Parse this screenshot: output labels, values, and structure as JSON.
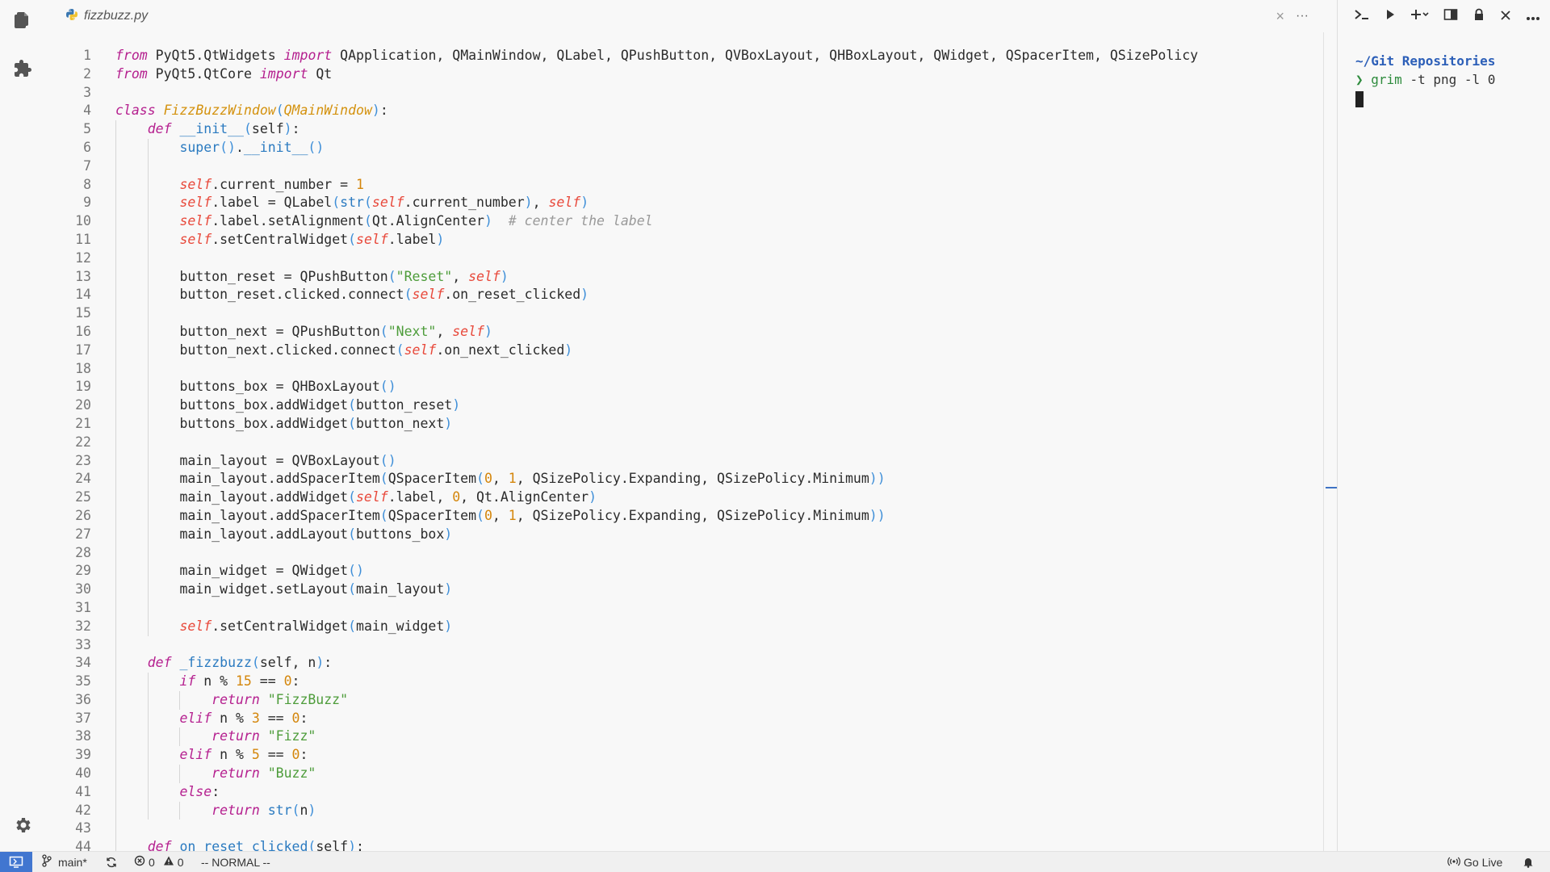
{
  "editor": {
    "tab": {
      "filename": "fizzbuzz.py",
      "icon": "python-icon",
      "close": "×",
      "more": "···"
    },
    "code_lines": [
      {
        "n": "1",
        "indent": 0,
        "t": [
          [
            "kw",
            "from"
          ],
          [
            "p",
            " PyQt5.QtWidgets "
          ],
          [
            "kw",
            "import"
          ],
          [
            "p",
            " QApplication, QMainWindow, QLabel, QPushButton, QVBoxLayout, QHBoxLayout, QWidget, QSpacerItem, QSizePolicy"
          ]
        ]
      },
      {
        "n": "2",
        "indent": 0,
        "t": [
          [
            "kw",
            "from"
          ],
          [
            "p",
            " PyQt5.QtCore "
          ],
          [
            "kw",
            "import"
          ],
          [
            "p",
            " Qt"
          ]
        ]
      },
      {
        "n": "3",
        "indent": 0,
        "t": []
      },
      {
        "n": "4",
        "indent": 0,
        "t": [
          [
            "kw",
            "class"
          ],
          [
            "p",
            " "
          ],
          [
            "cls",
            "FizzBuzzWindow"
          ],
          [
            "br",
            "("
          ],
          [
            "cls",
            "QMainWindow"
          ],
          [
            "br",
            ")"
          ],
          [
            "p",
            ":"
          ]
        ]
      },
      {
        "n": "5",
        "indent": 1,
        "t": [
          [
            "kw",
            "def"
          ],
          [
            "p",
            " "
          ],
          [
            "fn",
            "__init__"
          ],
          [
            "br",
            "("
          ],
          [
            "p",
            "self"
          ],
          [
            "br",
            ")"
          ],
          [
            "p",
            ":"
          ]
        ]
      },
      {
        "n": "6",
        "indent": 2,
        "t": [
          [
            "fn",
            "super"
          ],
          [
            "br",
            "()"
          ],
          [
            "p",
            "."
          ],
          [
            "fn",
            "__init__"
          ],
          [
            "br",
            "()"
          ]
        ]
      },
      {
        "n": "7",
        "indent": 2,
        "t": []
      },
      {
        "n": "8",
        "indent": 2,
        "t": [
          [
            "self",
            "self"
          ],
          [
            "p",
            ".current_number = "
          ],
          [
            "num",
            "1"
          ]
        ]
      },
      {
        "n": "9",
        "indent": 2,
        "t": [
          [
            "self",
            "self"
          ],
          [
            "p",
            ".label = QLabel"
          ],
          [
            "br",
            "("
          ],
          [
            "fn",
            "str"
          ],
          [
            "br",
            "("
          ],
          [
            "self",
            "self"
          ],
          [
            "p",
            ".current_number"
          ],
          [
            "br",
            ")"
          ],
          [
            "p",
            ", "
          ],
          [
            "self",
            "self"
          ],
          [
            "br",
            ")"
          ]
        ]
      },
      {
        "n": "10",
        "indent": 2,
        "t": [
          [
            "self",
            "self"
          ],
          [
            "p",
            ".label.setAlignment"
          ],
          [
            "br",
            "("
          ],
          [
            "p",
            "Qt.AlignCenter"
          ],
          [
            "br",
            ")"
          ],
          [
            "p",
            "  "
          ],
          [
            "cm",
            "# center the label"
          ]
        ]
      },
      {
        "n": "11",
        "indent": 2,
        "t": [
          [
            "self",
            "self"
          ],
          [
            "p",
            ".setCentralWidget"
          ],
          [
            "br",
            "("
          ],
          [
            "self",
            "self"
          ],
          [
            "p",
            ".label"
          ],
          [
            "br",
            ")"
          ]
        ]
      },
      {
        "n": "12",
        "indent": 2,
        "t": []
      },
      {
        "n": "13",
        "indent": 2,
        "t": [
          [
            "p",
            "button_reset = QPushButton"
          ],
          [
            "br",
            "("
          ],
          [
            "str",
            "\"Reset\""
          ],
          [
            "p",
            ", "
          ],
          [
            "self",
            "self"
          ],
          [
            "br",
            ")"
          ]
        ]
      },
      {
        "n": "14",
        "indent": 2,
        "t": [
          [
            "p",
            "button_reset.clicked.connect"
          ],
          [
            "br",
            "("
          ],
          [
            "self",
            "self"
          ],
          [
            "p",
            ".on_reset_clicked"
          ],
          [
            "br",
            ")"
          ]
        ]
      },
      {
        "n": "15",
        "indent": 2,
        "t": []
      },
      {
        "n": "16",
        "indent": 2,
        "t": [
          [
            "p",
            "button_next = QPushButton"
          ],
          [
            "br",
            "("
          ],
          [
            "str",
            "\"Next\""
          ],
          [
            "p",
            ", "
          ],
          [
            "self",
            "self"
          ],
          [
            "br",
            ")"
          ]
        ]
      },
      {
        "n": "17",
        "indent": 2,
        "t": [
          [
            "p",
            "button_next.clicked.connect"
          ],
          [
            "br",
            "("
          ],
          [
            "self",
            "self"
          ],
          [
            "p",
            ".on_next_clicked"
          ],
          [
            "br",
            ")"
          ]
        ]
      },
      {
        "n": "18",
        "indent": 2,
        "t": []
      },
      {
        "n": "19",
        "indent": 2,
        "t": [
          [
            "p",
            "buttons_box = QHBoxLayout"
          ],
          [
            "br",
            "()"
          ]
        ]
      },
      {
        "n": "20",
        "indent": 2,
        "t": [
          [
            "p",
            "buttons_box.addWidget"
          ],
          [
            "br",
            "("
          ],
          [
            "p",
            "button_reset"
          ],
          [
            "br",
            ")"
          ]
        ]
      },
      {
        "n": "21",
        "indent": 2,
        "t": [
          [
            "p",
            "buttons_box.addWidget"
          ],
          [
            "br",
            "("
          ],
          [
            "p",
            "button_next"
          ],
          [
            "br",
            ")"
          ]
        ]
      },
      {
        "n": "22",
        "indent": 2,
        "t": []
      },
      {
        "n": "23",
        "indent": 2,
        "t": [
          [
            "p",
            "main_layout = QVBoxLayout"
          ],
          [
            "br",
            "()"
          ]
        ]
      },
      {
        "n": "24",
        "indent": 2,
        "t": [
          [
            "p",
            "main_layout.addSpacerItem"
          ],
          [
            "br",
            "("
          ],
          [
            "p",
            "QSpacerItem"
          ],
          [
            "br",
            "("
          ],
          [
            "num",
            "0"
          ],
          [
            "p",
            ", "
          ],
          [
            "num",
            "1"
          ],
          [
            "p",
            ", QSizePolicy.Expanding, QSizePolicy.Minimum"
          ],
          [
            "br",
            "))"
          ]
        ]
      },
      {
        "n": "25",
        "indent": 2,
        "t": [
          [
            "p",
            "main_layout.addWidget"
          ],
          [
            "br",
            "("
          ],
          [
            "self",
            "self"
          ],
          [
            "p",
            ".label, "
          ],
          [
            "num",
            "0"
          ],
          [
            "p",
            ", Qt.AlignCenter"
          ],
          [
            "br",
            ")"
          ]
        ]
      },
      {
        "n": "26",
        "indent": 2,
        "t": [
          [
            "p",
            "main_layout.addSpacerItem"
          ],
          [
            "br",
            "("
          ],
          [
            "p",
            "QSpacerItem"
          ],
          [
            "br",
            "("
          ],
          [
            "num",
            "0"
          ],
          [
            "p",
            ", "
          ],
          [
            "num",
            "1"
          ],
          [
            "p",
            ", QSizePolicy.Expanding, QSizePolicy.Minimum"
          ],
          [
            "br",
            "))"
          ]
        ]
      },
      {
        "n": "27",
        "indent": 2,
        "t": [
          [
            "p",
            "main_layout.addLayout"
          ],
          [
            "br",
            "("
          ],
          [
            "p",
            "buttons_box"
          ],
          [
            "br",
            ")"
          ]
        ]
      },
      {
        "n": "28",
        "indent": 2,
        "t": []
      },
      {
        "n": "29",
        "indent": 2,
        "t": [
          [
            "p",
            "main_widget = QWidget"
          ],
          [
            "br",
            "()"
          ]
        ]
      },
      {
        "n": "30",
        "indent": 2,
        "t": [
          [
            "p",
            "main_widget.setLayout"
          ],
          [
            "br",
            "("
          ],
          [
            "p",
            "main_layout"
          ],
          [
            "br",
            ")"
          ]
        ]
      },
      {
        "n": "31",
        "indent": 2,
        "t": []
      },
      {
        "n": "32",
        "indent": 2,
        "t": [
          [
            "self",
            "self"
          ],
          [
            "p",
            ".setCentralWidget"
          ],
          [
            "br",
            "("
          ],
          [
            "p",
            "main_widget"
          ],
          [
            "br",
            ")"
          ]
        ]
      },
      {
        "n": "33",
        "indent": 1,
        "t": []
      },
      {
        "n": "34",
        "indent": 1,
        "t": [
          [
            "kw",
            "def"
          ],
          [
            "p",
            " "
          ],
          [
            "fn",
            "_fizzbuzz"
          ],
          [
            "br",
            "("
          ],
          [
            "p",
            "self, n"
          ],
          [
            "br",
            ")"
          ],
          [
            "p",
            ":"
          ]
        ]
      },
      {
        "n": "35",
        "indent": 2,
        "t": [
          [
            "kw",
            "if"
          ],
          [
            "p",
            " n % "
          ],
          [
            "num",
            "15"
          ],
          [
            "p",
            " == "
          ],
          [
            "num",
            "0"
          ],
          [
            "p",
            ":"
          ]
        ]
      },
      {
        "n": "36",
        "indent": 3,
        "t": [
          [
            "kw",
            "return"
          ],
          [
            "p",
            " "
          ],
          [
            "str",
            "\"FizzBuzz\""
          ]
        ]
      },
      {
        "n": "37",
        "indent": 2,
        "t": [
          [
            "kw",
            "elif"
          ],
          [
            "p",
            " n % "
          ],
          [
            "num",
            "3"
          ],
          [
            "p",
            " == "
          ],
          [
            "num",
            "0"
          ],
          [
            "p",
            ":"
          ]
        ]
      },
      {
        "n": "38",
        "indent": 3,
        "t": [
          [
            "kw",
            "return"
          ],
          [
            "p",
            " "
          ],
          [
            "str",
            "\"Fizz\""
          ]
        ]
      },
      {
        "n": "39",
        "indent": 2,
        "t": [
          [
            "kw",
            "elif"
          ],
          [
            "p",
            " n % "
          ],
          [
            "num",
            "5"
          ],
          [
            "p",
            " == "
          ],
          [
            "num",
            "0"
          ],
          [
            "p",
            ":"
          ]
        ]
      },
      {
        "n": "40",
        "indent": 3,
        "t": [
          [
            "kw",
            "return"
          ],
          [
            "p",
            " "
          ],
          [
            "str",
            "\"Buzz\""
          ]
        ]
      },
      {
        "n": "41",
        "indent": 2,
        "t": [
          [
            "kw",
            "else"
          ],
          [
            "p",
            ":"
          ]
        ]
      },
      {
        "n": "42",
        "indent": 3,
        "t": [
          [
            "kw",
            "return"
          ],
          [
            "p",
            " "
          ],
          [
            "fn",
            "str"
          ],
          [
            "br",
            "("
          ],
          [
            "p",
            "n"
          ],
          [
            "br",
            ")"
          ]
        ]
      },
      {
        "n": "43",
        "indent": 1,
        "t": []
      },
      {
        "n": "44",
        "indent": 1,
        "t": [
          [
            "kw",
            "def"
          ],
          [
            "p",
            " "
          ],
          [
            "fn",
            "on_reset_clicked"
          ],
          [
            "br",
            "("
          ],
          [
            "p",
            "self"
          ],
          [
            "br",
            ")"
          ],
          [
            "p",
            ":"
          ]
        ]
      }
    ],
    "syntax_colors": {
      "kw": "#b5208f",
      "self": "#e8483a",
      "fn": "#2a7ac0",
      "cls": "#d4920f",
      "br": "#3f8fd8",
      "str": "#4d9c3a",
      "num": "#d4860b",
      "cm": "#999999",
      "p": "#2b2b2b"
    }
  },
  "terminal": {
    "toolbar": [
      "terminal-icon",
      "run-icon",
      "new-terminal-icon",
      "split-icon",
      "lock-icon",
      "close-icon",
      "more-icon"
    ],
    "path": "~/Git Repositories",
    "prompt_symbol": "❯",
    "command": "grim",
    "args": " -t png -l 0"
  },
  "statusbar": {
    "branch": "main*",
    "errors": "0",
    "warnings": "0",
    "mode": "-- NORMAL --",
    "go_live": "Go Live"
  }
}
